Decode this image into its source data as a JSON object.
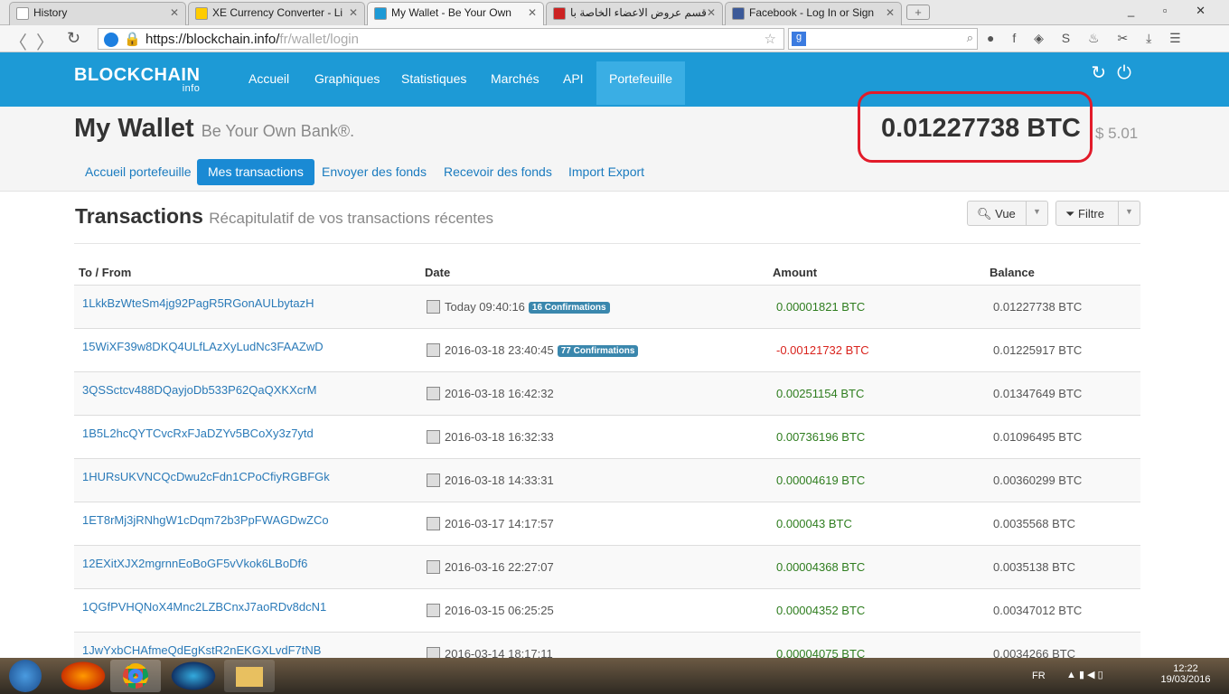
{
  "browser": {
    "tabs": [
      {
        "label": "History",
        "active": false
      },
      {
        "label": "XE Currency Converter - Li",
        "active": false
      },
      {
        "label": "My Wallet - Be Your Own",
        "active": true
      },
      {
        "label": "قسم عروض الاعضاء الخاصة با",
        "active": false
      },
      {
        "label": "Facebook - Log In or Sign",
        "active": false
      }
    ],
    "url_host": "https://blockchain.info/",
    "url_path": "fr/wallet/login"
  },
  "nav": {
    "logo": "BLOCKCHAIN",
    "logo_sub": "info",
    "items": [
      "Accueil",
      "Graphiques",
      "Statistiques",
      "Marchés",
      "API",
      "Portefeuille"
    ],
    "active": "Portefeuille",
    "accent": "#1d9ad6"
  },
  "header": {
    "title": "My Wallet",
    "subtitle": "Be Your Own Bank®.",
    "balance": "0.01227738 BTC",
    "balance_usd": "$ 5.01",
    "highlight_color": "#e21b2a",
    "subnav": [
      "Accueil portefeuille",
      "Mes transactions",
      "Envoyer des fonds",
      "Recevoir des fonds",
      "Import Export"
    ],
    "active": "Mes transactions"
  },
  "transactions": {
    "title": "Transactions",
    "subtitle": "Récapitulatif de vos transactions récentes",
    "view_btn": "Vue",
    "filter_btn": "Filtre",
    "columns": [
      "To / From",
      "Date",
      "Amount",
      "Balance"
    ],
    "rows": [
      {
        "address": "1LkkBzWteSm4jg92PagR5RGonAULbytazH",
        "date": "Today 09:40:16",
        "conf": "16 Confirmations",
        "amount": "0.00001821 BTC",
        "balance": "0.01227738 BTC",
        "neg": false
      },
      {
        "address": "15WiXF39w8DKQ4ULfLAzXyLudNc3FAAZwD",
        "date": "2016-03-18 23:40:45",
        "conf": "77 Confirmations",
        "amount": "-0.00121732 BTC",
        "balance": "0.01225917 BTC",
        "neg": true
      },
      {
        "address": "3QSSctcv488DQayjoDb533P62QaQXKXcrM",
        "date": "2016-03-18 16:42:32",
        "amount": "0.00251154 BTC",
        "balance": "0.01347649 BTC",
        "neg": false
      },
      {
        "address": "1B5L2hcQYTCvcRxFJaDZYv5BCoXy3z7ytd",
        "date": "2016-03-18 16:32:33",
        "amount": "0.00736196 BTC",
        "balance": "0.01096495 BTC",
        "neg": false
      },
      {
        "address": "1HURsUKVNCQcDwu2cFdn1CPoCfiyRGBFGk",
        "date": "2016-03-18 14:33:31",
        "amount": "0.00004619 BTC",
        "balance": "0.00360299 BTC",
        "neg": false
      },
      {
        "address": "1ET8rMj3jRNhgW1cDqm72b3PpFWAGDwZCo",
        "date": "2016-03-17 14:17:57",
        "amount": "0.000043 BTC",
        "balance": "0.0035568 BTC",
        "neg": false
      },
      {
        "address": "12EXitXJX2mgrnnEoBoGF5vVkok6LBoDf6",
        "date": "2016-03-16 22:27:07",
        "amount": "0.00004368 BTC",
        "balance": "0.0035138 BTC",
        "neg": false
      },
      {
        "address": "1QGfPVHQNoX4Mnc2LZBCnxJ7aoRDv8dcN1",
        "date": "2016-03-15 06:25:25",
        "amount": "0.00004352 BTC",
        "balance": "0.00347012 BTC",
        "neg": false
      },
      {
        "address": "1JwYxbCHAfmeQdEgKstR2nEKGXLvdF7tNB",
        "date": "2016-03-14 18:17:11",
        "amount": "0.00004075 BTC",
        "balance": "0.0034266 BTC",
        "neg": false
      }
    ]
  },
  "taskbar": {
    "lang": "FR",
    "time": "12:22",
    "date": "19/03/2016"
  }
}
